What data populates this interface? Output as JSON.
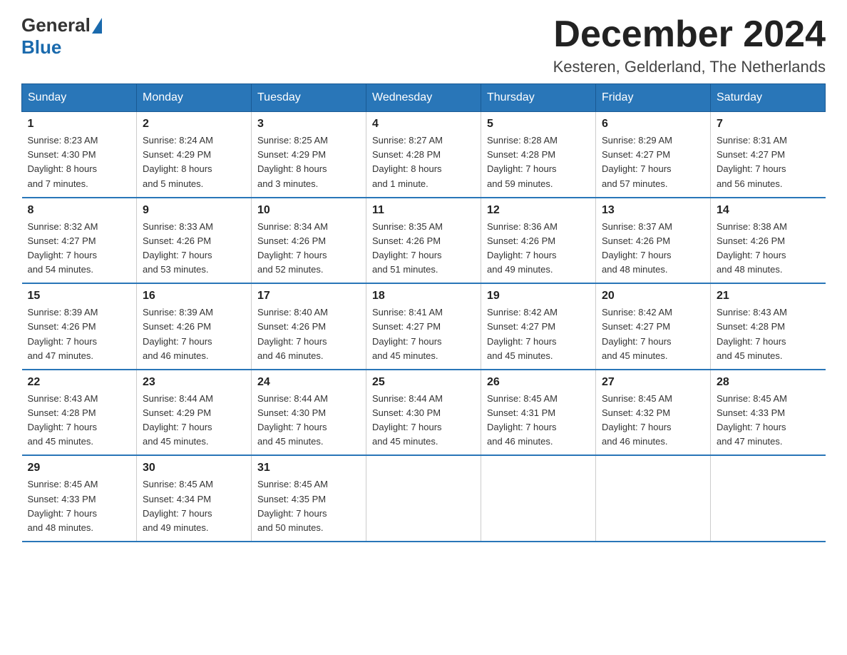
{
  "logo": {
    "general": "General",
    "blue": "Blue"
  },
  "title": "December 2024",
  "location": "Kesteren, Gelderland, The Netherlands",
  "days_of_week": [
    "Sunday",
    "Monday",
    "Tuesday",
    "Wednesday",
    "Thursday",
    "Friday",
    "Saturday"
  ],
  "weeks": [
    [
      {
        "day": "1",
        "sunrise": "8:23 AM",
        "sunset": "4:30 PM",
        "daylight": "8 hours and 7 minutes."
      },
      {
        "day": "2",
        "sunrise": "8:24 AM",
        "sunset": "4:29 PM",
        "daylight": "8 hours and 5 minutes."
      },
      {
        "day": "3",
        "sunrise": "8:25 AM",
        "sunset": "4:29 PM",
        "daylight": "8 hours and 3 minutes."
      },
      {
        "day": "4",
        "sunrise": "8:27 AM",
        "sunset": "4:28 PM",
        "daylight": "8 hours and 1 minute."
      },
      {
        "day": "5",
        "sunrise": "8:28 AM",
        "sunset": "4:28 PM",
        "daylight": "7 hours and 59 minutes."
      },
      {
        "day": "6",
        "sunrise": "8:29 AM",
        "sunset": "4:27 PM",
        "daylight": "7 hours and 57 minutes."
      },
      {
        "day": "7",
        "sunrise": "8:31 AM",
        "sunset": "4:27 PM",
        "daylight": "7 hours and 56 minutes."
      }
    ],
    [
      {
        "day": "8",
        "sunrise": "8:32 AM",
        "sunset": "4:27 PM",
        "daylight": "7 hours and 54 minutes."
      },
      {
        "day": "9",
        "sunrise": "8:33 AM",
        "sunset": "4:26 PM",
        "daylight": "7 hours and 53 minutes."
      },
      {
        "day": "10",
        "sunrise": "8:34 AM",
        "sunset": "4:26 PM",
        "daylight": "7 hours and 52 minutes."
      },
      {
        "day": "11",
        "sunrise": "8:35 AM",
        "sunset": "4:26 PM",
        "daylight": "7 hours and 51 minutes."
      },
      {
        "day": "12",
        "sunrise": "8:36 AM",
        "sunset": "4:26 PM",
        "daylight": "7 hours and 49 minutes."
      },
      {
        "day": "13",
        "sunrise": "8:37 AM",
        "sunset": "4:26 PM",
        "daylight": "7 hours and 48 minutes."
      },
      {
        "day": "14",
        "sunrise": "8:38 AM",
        "sunset": "4:26 PM",
        "daylight": "7 hours and 48 minutes."
      }
    ],
    [
      {
        "day": "15",
        "sunrise": "8:39 AM",
        "sunset": "4:26 PM",
        "daylight": "7 hours and 47 minutes."
      },
      {
        "day": "16",
        "sunrise": "8:39 AM",
        "sunset": "4:26 PM",
        "daylight": "7 hours and 46 minutes."
      },
      {
        "day": "17",
        "sunrise": "8:40 AM",
        "sunset": "4:26 PM",
        "daylight": "7 hours and 46 minutes."
      },
      {
        "day": "18",
        "sunrise": "8:41 AM",
        "sunset": "4:27 PM",
        "daylight": "7 hours and 45 minutes."
      },
      {
        "day": "19",
        "sunrise": "8:42 AM",
        "sunset": "4:27 PM",
        "daylight": "7 hours and 45 minutes."
      },
      {
        "day": "20",
        "sunrise": "8:42 AM",
        "sunset": "4:27 PM",
        "daylight": "7 hours and 45 minutes."
      },
      {
        "day": "21",
        "sunrise": "8:43 AM",
        "sunset": "4:28 PM",
        "daylight": "7 hours and 45 minutes."
      }
    ],
    [
      {
        "day": "22",
        "sunrise": "8:43 AM",
        "sunset": "4:28 PM",
        "daylight": "7 hours and 45 minutes."
      },
      {
        "day": "23",
        "sunrise": "8:44 AM",
        "sunset": "4:29 PM",
        "daylight": "7 hours and 45 minutes."
      },
      {
        "day": "24",
        "sunrise": "8:44 AM",
        "sunset": "4:30 PM",
        "daylight": "7 hours and 45 minutes."
      },
      {
        "day": "25",
        "sunrise": "8:44 AM",
        "sunset": "4:30 PM",
        "daylight": "7 hours and 45 minutes."
      },
      {
        "day": "26",
        "sunrise": "8:45 AM",
        "sunset": "4:31 PM",
        "daylight": "7 hours and 46 minutes."
      },
      {
        "day": "27",
        "sunrise": "8:45 AM",
        "sunset": "4:32 PM",
        "daylight": "7 hours and 46 minutes."
      },
      {
        "day": "28",
        "sunrise": "8:45 AM",
        "sunset": "4:33 PM",
        "daylight": "7 hours and 47 minutes."
      }
    ],
    [
      {
        "day": "29",
        "sunrise": "8:45 AM",
        "sunset": "4:33 PM",
        "daylight": "7 hours and 48 minutes."
      },
      {
        "day": "30",
        "sunrise": "8:45 AM",
        "sunset": "4:34 PM",
        "daylight": "7 hours and 49 minutes."
      },
      {
        "day": "31",
        "sunrise": "8:45 AM",
        "sunset": "4:35 PM",
        "daylight": "7 hours and 50 minutes."
      },
      null,
      null,
      null,
      null
    ]
  ],
  "labels": {
    "sunrise": "Sunrise:",
    "sunset": "Sunset:",
    "daylight": "Daylight:"
  }
}
